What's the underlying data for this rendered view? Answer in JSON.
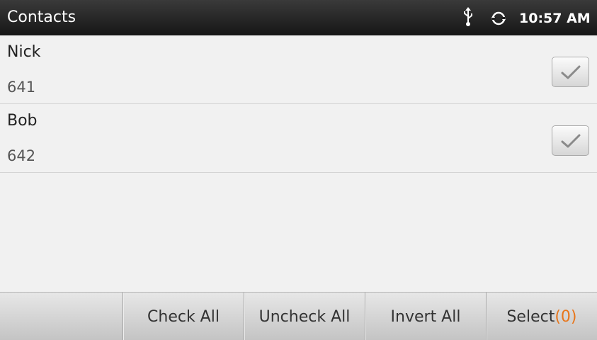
{
  "statusbar": {
    "title": "Contacts",
    "time": "10:57 AM",
    "icons": [
      "usb-icon",
      "sync-icon"
    ]
  },
  "contacts": [
    {
      "name": "Nick",
      "number": "641",
      "checked": true
    },
    {
      "name": "Bob",
      "number": "642",
      "checked": true
    }
  ],
  "toolbar": {
    "check_all": "Check All",
    "uncheck_all": "Uncheck All",
    "invert_all": "Invert All",
    "select_label": "Select",
    "select_count": "(0)"
  },
  "colors": {
    "statusbar": "#1f1f1f",
    "background": "#f1f1f1",
    "accent": "#e8761b"
  }
}
